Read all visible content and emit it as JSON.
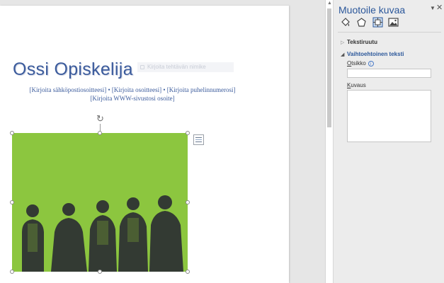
{
  "document": {
    "name": "Ossi Opiskelija",
    "faint_field_text": "Kirjoita tehtävän nimike",
    "contact_line1": "[Kirjoita sähköpostiosoitteesi] •  [Kirjoita osoitteesi] • [Kirjoita puhelinnumerosi]",
    "contact_line2": "[Kirjoita WWW-sivustosi osoite]",
    "picture": {
      "background_color": "#8cc63f",
      "people_count": 5
    }
  },
  "pane": {
    "title": "Muotoile kuvaa",
    "tabs": [
      {
        "name": "fill-line",
        "icon": "paint-bucket-icon"
      },
      {
        "name": "effects",
        "icon": "pentagon-icon"
      },
      {
        "name": "size-properties",
        "icon": "size-properties-icon"
      },
      {
        "name": "picture",
        "icon": "picture-icon"
      }
    ],
    "sections": {
      "text_box": "Tekstiruutu",
      "alt_text": "Vaihtoehtoinen teksti"
    },
    "fields": {
      "title_label_accel": "O",
      "title_label_rest": "tsikko",
      "title_value": "",
      "desc_label_accel": "K",
      "desc_label_rest": "uvaus",
      "desc_value": ""
    },
    "accent_color": "#2b579a"
  }
}
